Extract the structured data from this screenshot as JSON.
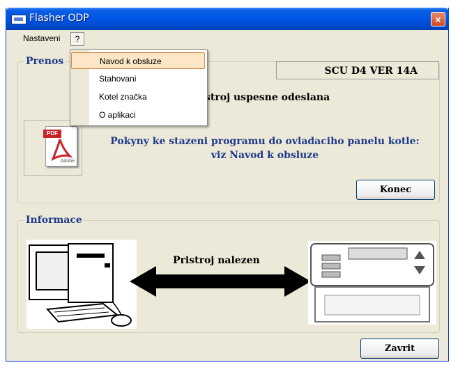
{
  "window": {
    "title": "Flasher ODP",
    "close_glyph": "×",
    "app_icon": "monitor-app-icon"
  },
  "menubar": {
    "items": [
      "Nastaveni",
      "?"
    ]
  },
  "dropdown": {
    "items": [
      "Navod k obsluze",
      "Stahovani",
      "Kotel značka",
      "O aplikaci"
    ],
    "selected_index": 0
  },
  "prenos": {
    "title": "Prenos",
    "version": "SCU D4 VER  14A",
    "status_partial": "stroj uspesne odeslana",
    "instruction_line1": "Pokyny ke stazeni programu do ovladaciho panelu kotle:",
    "instruction_line2": "viz Navod k obsluze",
    "pdf_badge": "PDF",
    "pdf_caption": "Adobe",
    "konec_label": "Konec"
  },
  "informace": {
    "title": "Informace",
    "found_text": "Pristroj nalezen",
    "zavrit_label": "Zavrit"
  },
  "colors": {
    "title_blue": "#0055e5",
    "heading_blue": "#1e3a8c",
    "menu_highlight": "#fde6c6",
    "close_red": "#d0491e"
  }
}
